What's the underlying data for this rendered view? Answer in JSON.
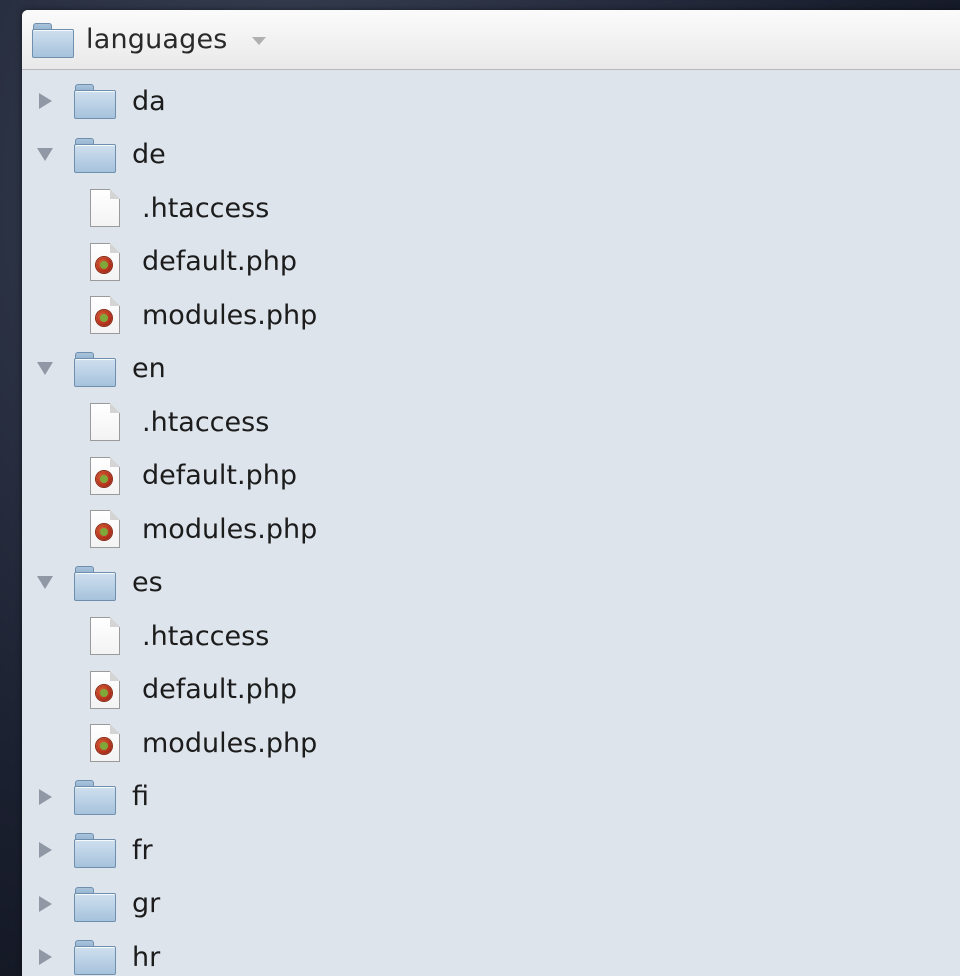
{
  "header": {
    "title": "languages",
    "icon": "folder-icon",
    "menu_icon": "chevron-down-icon"
  },
  "tree": [
    {
      "type": "folder",
      "name": "da",
      "expanded": false
    },
    {
      "type": "folder",
      "name": "de",
      "expanded": true
    },
    {
      "type": "file",
      "name": ".htaccess",
      "kind": "plain"
    },
    {
      "type": "file",
      "name": "default.php",
      "kind": "php"
    },
    {
      "type": "file",
      "name": "modules.php",
      "kind": "php"
    },
    {
      "type": "folder",
      "name": "en",
      "expanded": true
    },
    {
      "type": "file",
      "name": ".htaccess",
      "kind": "plain"
    },
    {
      "type": "file",
      "name": "default.php",
      "kind": "php"
    },
    {
      "type": "file",
      "name": "modules.php",
      "kind": "php"
    },
    {
      "type": "folder",
      "name": "es",
      "expanded": true
    },
    {
      "type": "file",
      "name": ".htaccess",
      "kind": "plain"
    },
    {
      "type": "file",
      "name": "default.php",
      "kind": "php"
    },
    {
      "type": "file",
      "name": "modules.php",
      "kind": "php"
    },
    {
      "type": "folder",
      "name": "fi",
      "expanded": false
    },
    {
      "type": "folder",
      "name": "fr",
      "expanded": false
    },
    {
      "type": "folder",
      "name": "gr",
      "expanded": false
    },
    {
      "type": "folder",
      "name": "hr",
      "expanded": false
    }
  ],
  "colors": {
    "panel_background": "#dde4ec",
    "folder_blue": "#a6c2dc",
    "disclosure_gray": "#8f98a4",
    "php_red": "#b8341e"
  }
}
